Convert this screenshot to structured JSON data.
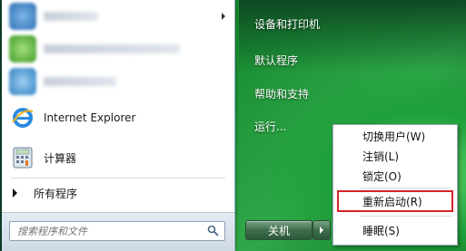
{
  "start_menu": {
    "pinned": [
      {
        "label": "",
        "blurred": true,
        "icon": "blurred-app-icon-1"
      },
      {
        "label": "",
        "blurred": true,
        "icon": "blurred-app-icon-2"
      },
      {
        "label": "",
        "blurred": true,
        "icon": "blurred-app-icon-3"
      }
    ],
    "ie_label": "Internet Explorer",
    "calc_label": "计算器",
    "all_programs": "所有程序",
    "search_placeholder": "搜索程序和文件"
  },
  "right_column": {
    "devices": "设备和打印机",
    "defaults": "默认程序",
    "help": "帮助和支持",
    "run": "运行...",
    "shutdown": "关机"
  },
  "power_menu": {
    "switch_user": "切换用户(W)",
    "logoff": "注销(L)",
    "lock": "锁定(O)",
    "restart": "重新启动(R)",
    "sleep": "睡眠(S)"
  },
  "colors": {
    "highlight_border": "#d6242b",
    "desktop_green": "#1a8f33"
  }
}
